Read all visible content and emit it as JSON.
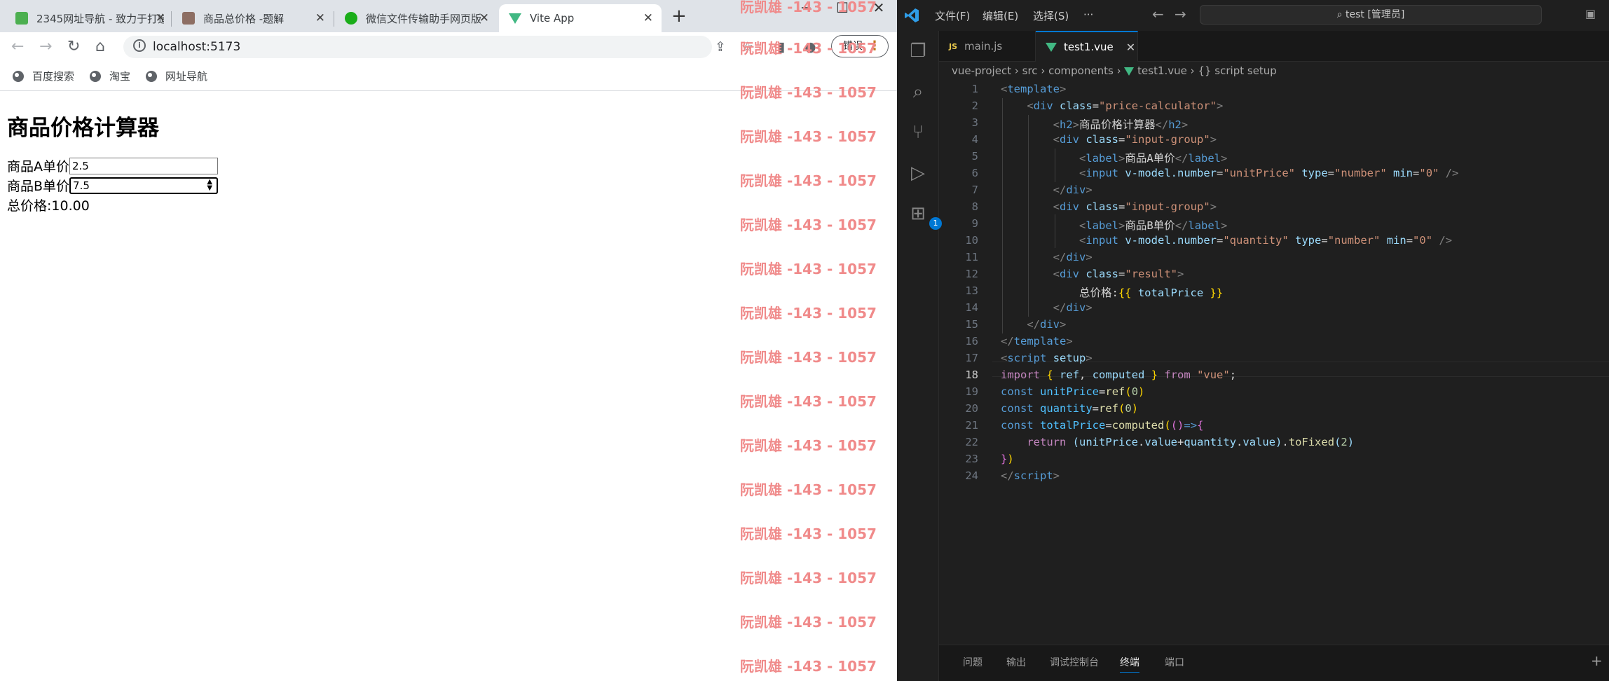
{
  "browser": {
    "tabs": [
      {
        "title": "2345网址导航 - 致力于打造...",
        "active": false
      },
      {
        "title": "商品总价格 -题解",
        "active": false
      },
      {
        "title": "微信文件传输助手网页版",
        "active": false
      },
      {
        "title": "Vite App",
        "active": true
      }
    ],
    "new_tab_symbol": "+",
    "url": "localhost:5173",
    "profile_label": "错误",
    "bookmarks": [
      "百度搜索",
      "淘宝",
      "网址导航"
    ]
  },
  "app": {
    "heading": "商品价格计算器",
    "label_a": "商品A单价",
    "value_a": "2.5",
    "label_b": "商品B单价",
    "value_b": "7.5",
    "result": "总价格:10.00"
  },
  "watermark": {
    "text": "阮凯雄 -143 - 1057",
    "color": "#f08a8a"
  },
  "vscode": {
    "menus": [
      "文件(F)",
      "编辑(E)",
      "选择(S)",
      "···"
    ],
    "search": "test [管理员]",
    "tabs": [
      {
        "name": "main.js",
        "icon": "JS",
        "active": false
      },
      {
        "name": "test1.vue",
        "icon": "vue-icon",
        "active": true
      }
    ],
    "breadcrumb": {
      "project": "vue-project",
      "src": "src",
      "components": "components",
      "file": "test1.vue",
      "symbol": "{} script setup"
    },
    "badge_count": "1",
    "current_line": 18,
    "line_numbers": [
      "1",
      "2",
      "3",
      "4",
      "5",
      "6",
      "7",
      "8",
      "9",
      "10",
      "11",
      "12",
      "13",
      "14",
      "15",
      "16",
      "17",
      "18",
      "19",
      "20",
      "21",
      "22",
      "23",
      "24"
    ],
    "panel_tabs": [
      "问题",
      "输出",
      "调试控制台",
      "终端",
      "端口"
    ],
    "active_panel": "终端",
    "accent": "#0078d4"
  }
}
